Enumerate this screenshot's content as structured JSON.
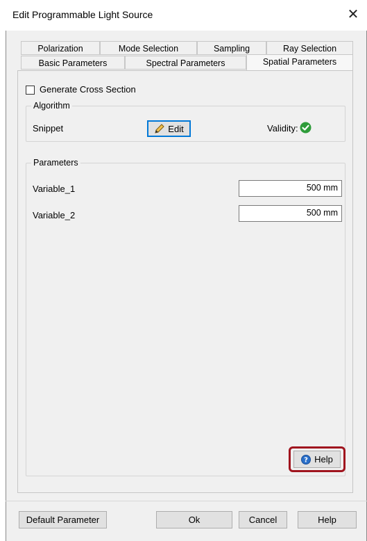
{
  "window": {
    "title": "Edit Programmable Light Source",
    "close_glyph": "✕"
  },
  "tabs": {
    "row1": [
      "Polarization",
      "Mode Selection",
      "Sampling",
      "Ray Selection"
    ],
    "row2": [
      "Basic Parameters",
      "Spectral Parameters",
      "Spatial Parameters"
    ],
    "active": "Spatial Parameters"
  },
  "generate_cross_section": {
    "label": "Generate Cross Section",
    "checked": false
  },
  "algorithm": {
    "group_label": "Algorithm",
    "snippet_label": "Snippet",
    "edit_button": "Edit",
    "validity_label": "Validity:",
    "validity_icon": "check-circle-icon",
    "validity_color": "#2e9c3a"
  },
  "parameters": {
    "group_label": "Parameters",
    "rows": [
      {
        "name": "Variable_1",
        "value": "500 mm"
      },
      {
        "name": "Variable_2",
        "value": "500 mm"
      }
    ],
    "help_button": "Help",
    "help_icon": "help-circle-icon",
    "highlight_color": "#a0141e"
  },
  "footer": {
    "default_button": "Default Parameter",
    "ok_button": "Ok",
    "cancel_button": "Cancel",
    "help_button": "Help"
  }
}
